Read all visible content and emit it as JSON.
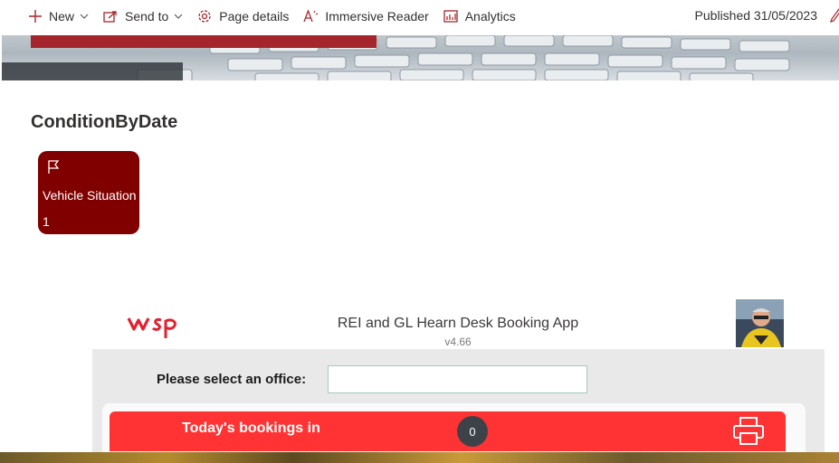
{
  "command_bar": {
    "new_label": "New",
    "send_to_label": "Send to",
    "page_details_label": "Page details",
    "immersive_reader_label": "Immersive Reader",
    "analytics_label": "Analytics",
    "published": "Published 31/05/2023"
  },
  "section": {
    "title": "ConditionByDate",
    "tile": {
      "label": "Vehicle Situation",
      "count": "1",
      "color": "#800000"
    }
  },
  "app": {
    "logo_text": "wsp",
    "title": "REI and GL Hearn Desk Booking App",
    "version": "v4.66",
    "office_label": "Please select an office:",
    "office_value": "",
    "bookings_label": "Today's bookings in",
    "bookings_count": "0",
    "accent_color": "#ff3333"
  },
  "icons": {
    "new": "plus-icon",
    "send_to": "share-icon",
    "page_details": "gear-icon",
    "immersive_reader": "reader-icon",
    "analytics": "chart-icon",
    "edit": "pencil-icon",
    "tile": "flag-icon",
    "print": "printer-icon"
  }
}
